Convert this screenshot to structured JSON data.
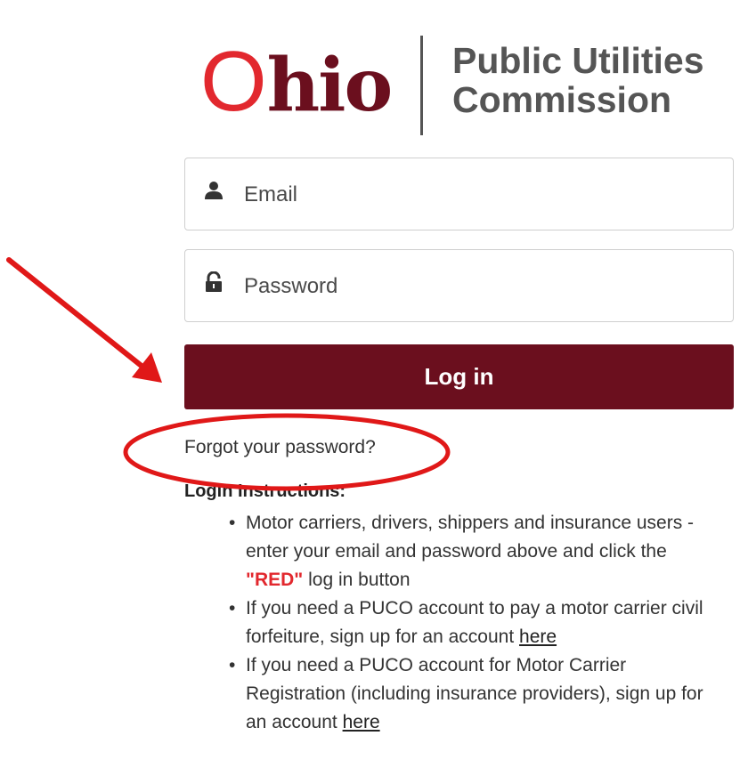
{
  "logo": {
    "ohio_first_letter": "O",
    "ohio_rest": "hio",
    "agency_line1": "Public Utilities",
    "agency_line2": "Commission"
  },
  "email_field": {
    "placeholder": "Email",
    "icon": "user-icon"
  },
  "password_field": {
    "placeholder": "Password",
    "icon": "lock-icon"
  },
  "login_button": {
    "label": "Log in"
  },
  "forgot_link": {
    "label": "Forgot your password?"
  },
  "instructions": {
    "title": "Login Instructions:",
    "item1": {
      "before": "Motor carriers, drivers, shippers and insurance users - enter your email and password above and click the ",
      "highlight": "\"RED\"",
      "after": " log in button"
    },
    "item2": {
      "before": "If you need a PUCO account to pay a motor carrier civil forfeiture, sign up for an account ",
      "link": "here"
    },
    "item3": {
      "before": "If you need a PUCO account for Motor Carrier Registration (including insurance providers), sign up for an account ",
      "link": "here"
    }
  },
  "colors": {
    "brand_maroon": "#6b0f1e",
    "brand_red": "#e2282e",
    "annotation_red": "#e01818"
  }
}
